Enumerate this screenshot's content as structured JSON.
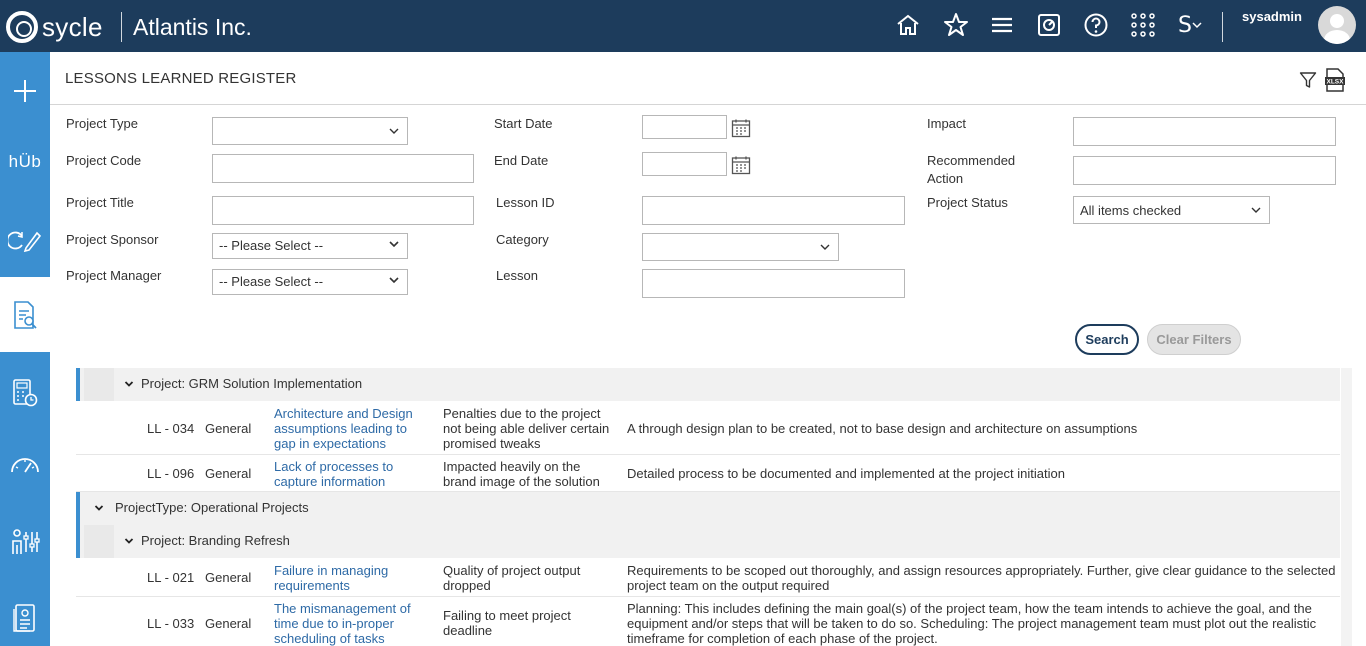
{
  "header": {
    "logo_text": "sycle",
    "company": "Atlantis Inc.",
    "user_menu_initial": "S",
    "username": "sysadmin"
  },
  "page": {
    "title": "LESSONS LEARNED REGISTER"
  },
  "filters": {
    "project_type_label": "Project Type",
    "project_type_value": "",
    "project_code_label": "Project Code",
    "project_title_label": "Project Title",
    "project_sponsor_label": "Project Sponsor",
    "project_sponsor_value": "-- Please Select --",
    "project_manager_label": "Project Manager",
    "project_manager_value": "-- Please Select --",
    "start_date_label": "Start Date",
    "end_date_label": "End Date",
    "lesson_id_label": "Lesson ID",
    "category_label": "Category",
    "category_value": "",
    "lesson_label": "Lesson",
    "impact_label": "Impact",
    "recommended_action_label": "Recommended Action",
    "project_status_label": "Project Status",
    "project_status_value": "All items checked",
    "search_button": "Search",
    "clear_button": "Clear Filters"
  },
  "grid": {
    "group1_label": "Project: GRM Solution Implementation",
    "rows1": [
      {
        "id": "LL - 034",
        "category": "General",
        "lesson": [
          "Architecture and Design",
          "assumptions leading to",
          "gap in expectations"
        ],
        "impact": [
          "Penalties due to the project",
          "not being able deliver certain",
          "promised tweaks"
        ],
        "action": [
          "A through design plan to be created, not to base design and architecture on assumptions"
        ]
      },
      {
        "id": "LL - 096",
        "category": "General",
        "lesson": [
          "Lack of processes to",
          "capture information"
        ],
        "impact": [
          "Impacted heavily on the",
          "brand image of the solution"
        ],
        "action": [
          "Detailed process to be documented and implemented at the project initiation"
        ]
      }
    ],
    "type_group_label": "ProjectType: Operational Projects",
    "group2_label": "Project: Branding Refresh",
    "rows2": [
      {
        "id": "LL - 021",
        "category": "General",
        "lesson": [
          "Failure in managing",
          "requirements"
        ],
        "impact": [
          "Quality of project output",
          "dropped"
        ],
        "action": [
          "Requirements to be scoped out thoroughly, and assign resources appropriately. Further, give clear guidance to the selected",
          "project team on the output required"
        ]
      },
      {
        "id": "LL - 033",
        "category": "General",
        "lesson": [
          "The mismanagement of",
          "time due to in-proper",
          "scheduling of tasks"
        ],
        "impact": [
          "Failing to meet project",
          "deadline"
        ],
        "action": [
          "Planning: This includes defining the main goal(s) of the project team, how the team intends to achieve the goal, and the",
          "equipment and/or steps that will be taken to do so. Scheduling: The project management team must plot out the realistic",
          "timeframe for completion of each phase of the project."
        ]
      }
    ]
  },
  "colors": {
    "header_bg": "#1d3c5c",
    "sidebar_bg": "#3b8fd0",
    "link": "#2e6aa6"
  },
  "icons": {
    "header": [
      "home-icon",
      "star-icon",
      "menu-icon",
      "dashboard-icon",
      "help-icon",
      "apps-grid-icon",
      "chevron-down-icon"
    ],
    "sidebar": [
      "plus-icon",
      "hub-text",
      "refresh-edit-icon",
      "document-search-icon",
      "calculator-clock-icon",
      "gauge-icon",
      "people-settings-icon",
      "report-icon"
    ],
    "toolbar": [
      "filter-icon",
      "xlsx-export-icon"
    ]
  }
}
